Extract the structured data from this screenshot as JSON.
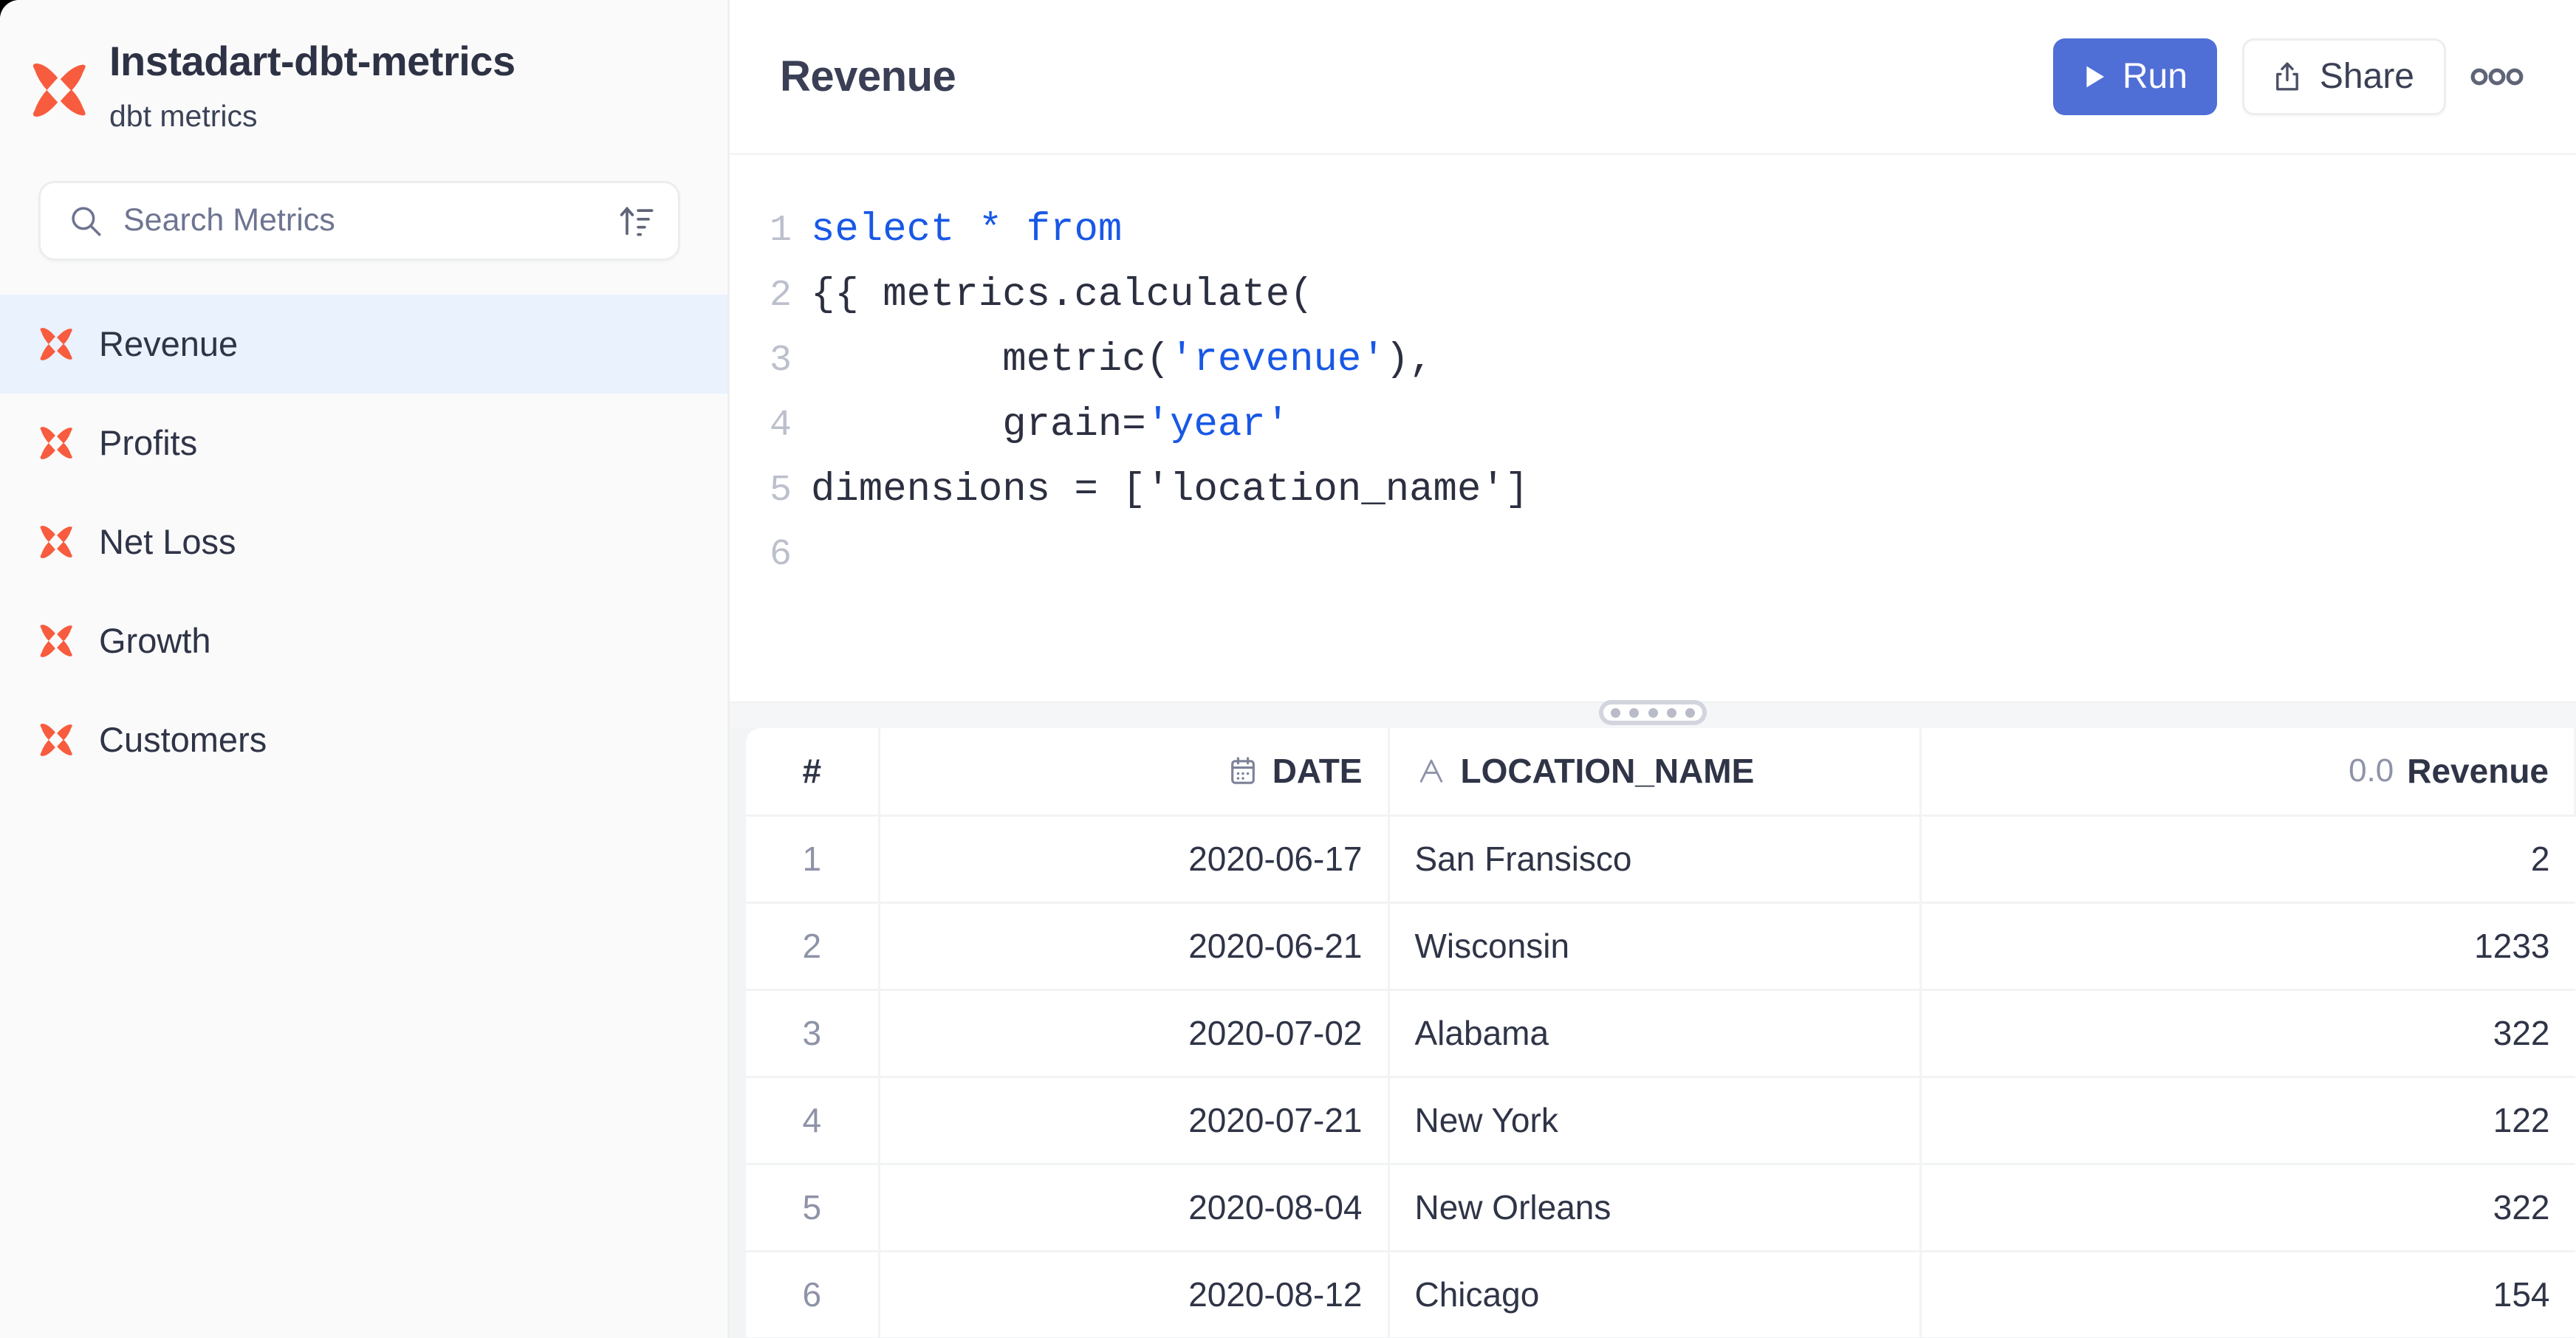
{
  "sidebar": {
    "brand": {
      "title": "Instadart-dbt-metrics",
      "subtitle": "dbt metrics",
      "logo_icon": "dbt-x-logo-icon",
      "logo_color": "#f85c3e"
    },
    "search": {
      "placeholder": "Search Metrics",
      "value": "",
      "search_icon": "search-icon",
      "sort_icon": "sort-ascending-icon"
    },
    "items": [
      {
        "label": "Revenue",
        "icon": "metric-x-icon",
        "active": true
      },
      {
        "label": "Profits",
        "icon": "metric-x-icon",
        "active": false
      },
      {
        "label": "Net Loss",
        "icon": "metric-x-icon",
        "active": false
      },
      {
        "label": "Growth",
        "icon": "metric-x-icon",
        "active": false
      },
      {
        "label": "Customers",
        "icon": "metric-x-icon",
        "active": false
      }
    ]
  },
  "toolbar": {
    "title": "Revenue",
    "run_label": "Run",
    "share_label": "Share",
    "run_icon": "play-icon",
    "share_icon": "share-upload-icon",
    "more_icon": "more-horizontal-icon",
    "run_color": "#4f6fd6"
  },
  "editor": {
    "lines": [
      {
        "num": "1",
        "tokens": [
          {
            "t": "select * from",
            "c": "kw"
          }
        ]
      },
      {
        "num": "2",
        "tokens": [
          {
            "t": "{{ metrics.calculate(",
            "c": "plain"
          }
        ]
      },
      {
        "num": "3",
        "tokens": [
          {
            "t": "        metric(",
            "c": "plain"
          },
          {
            "t": "'revenue'",
            "c": "str"
          },
          {
            "t": "),",
            "c": "plain"
          }
        ]
      },
      {
        "num": "4",
        "tokens": [
          {
            "t": "        grain=",
            "c": "plain"
          },
          {
            "t": "'year'",
            "c": "str"
          }
        ]
      },
      {
        "num": "5",
        "tokens": [
          {
            "t": "dimensions = [",
            "c": "plain"
          },
          {
            "t": "'location_name'",
            "c": "plain"
          },
          {
            "t": "]",
            "c": "plain"
          }
        ]
      },
      {
        "num": "6",
        "tokens": [
          {
            "t": "",
            "c": "plain"
          }
        ]
      }
    ]
  },
  "splitter": {
    "handle_icon": "drag-handle-icon",
    "dots": 5
  },
  "results": {
    "columns": [
      {
        "key": "idx",
        "label": "#",
        "type_icon": "hash-icon",
        "align": "center"
      },
      {
        "key": "date",
        "label": "DATE",
        "type_icon": "calendar-icon",
        "align": "right"
      },
      {
        "key": "loc",
        "label": "LOCATION_NAME",
        "type_icon": "text-type-icon",
        "align": "left"
      },
      {
        "key": "rev",
        "label": "Revenue",
        "type_icon": "number-type-icon",
        "type_label": "0.0",
        "align": "right"
      }
    ],
    "rows": [
      {
        "idx": "1",
        "date": "2020-06-17",
        "loc": "San Fransisco",
        "rev": "2"
      },
      {
        "idx": "2",
        "date": "2020-06-21",
        "loc": "Wisconsin",
        "rev": "1233"
      },
      {
        "idx": "3",
        "date": "2020-07-02",
        "loc": "Alabama",
        "rev": "322"
      },
      {
        "idx": "4",
        "date": "2020-07-21",
        "loc": "New York",
        "rev": "122"
      },
      {
        "idx": "5",
        "date": "2020-08-04",
        "loc": "New Orleans",
        "rev": "322"
      },
      {
        "idx": "6",
        "date": "2020-08-12",
        "loc": "Chicago",
        "rev": "154"
      }
    ]
  }
}
